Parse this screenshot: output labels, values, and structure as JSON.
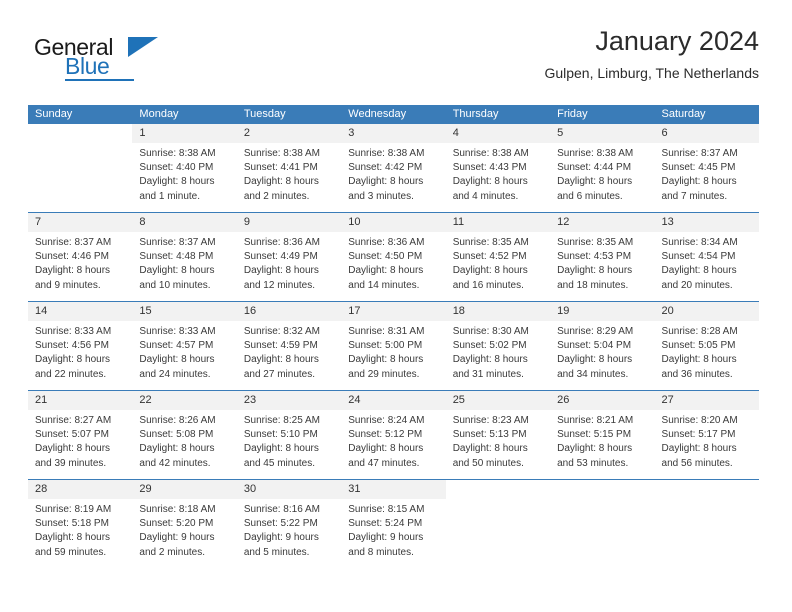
{
  "brand": {
    "name_part1": "General",
    "name_part2": "Blue",
    "logo_icon": "triangle-flag-icon"
  },
  "header": {
    "title": "January 2024",
    "subtitle": "Gulpen, Limburg, The Netherlands"
  },
  "colors": {
    "header_blue": "#3a7cb8",
    "brand_blue": "#1f72b8",
    "day_band_gray": "#f2f2f2",
    "text": "#3a3a3a"
  },
  "weekdays": [
    "Sunday",
    "Monday",
    "Tuesday",
    "Wednesday",
    "Thursday",
    "Friday",
    "Saturday"
  ],
  "weeks": [
    [
      {
        "day": "",
        "lines": [
          "",
          "",
          "",
          ""
        ]
      },
      {
        "day": "1",
        "lines": [
          "Sunrise: 8:38 AM",
          "Sunset: 4:40 PM",
          "Daylight: 8 hours",
          "and 1 minute."
        ]
      },
      {
        "day": "2",
        "lines": [
          "Sunrise: 8:38 AM",
          "Sunset: 4:41 PM",
          "Daylight: 8 hours",
          "and 2 minutes."
        ]
      },
      {
        "day": "3",
        "lines": [
          "Sunrise: 8:38 AM",
          "Sunset: 4:42 PM",
          "Daylight: 8 hours",
          "and 3 minutes."
        ]
      },
      {
        "day": "4",
        "lines": [
          "Sunrise: 8:38 AM",
          "Sunset: 4:43 PM",
          "Daylight: 8 hours",
          "and 4 minutes."
        ]
      },
      {
        "day": "5",
        "lines": [
          "Sunrise: 8:38 AM",
          "Sunset: 4:44 PM",
          "Daylight: 8 hours",
          "and 6 minutes."
        ]
      },
      {
        "day": "6",
        "lines": [
          "Sunrise: 8:37 AM",
          "Sunset: 4:45 PM",
          "Daylight: 8 hours",
          "and 7 minutes."
        ]
      }
    ],
    [
      {
        "day": "7",
        "lines": [
          "Sunrise: 8:37 AM",
          "Sunset: 4:46 PM",
          "Daylight: 8 hours",
          "and 9 minutes."
        ]
      },
      {
        "day": "8",
        "lines": [
          "Sunrise: 8:37 AM",
          "Sunset: 4:48 PM",
          "Daylight: 8 hours",
          "and 10 minutes."
        ]
      },
      {
        "day": "9",
        "lines": [
          "Sunrise: 8:36 AM",
          "Sunset: 4:49 PM",
          "Daylight: 8 hours",
          "and 12 minutes."
        ]
      },
      {
        "day": "10",
        "lines": [
          "Sunrise: 8:36 AM",
          "Sunset: 4:50 PM",
          "Daylight: 8 hours",
          "and 14 minutes."
        ]
      },
      {
        "day": "11",
        "lines": [
          "Sunrise: 8:35 AM",
          "Sunset: 4:52 PM",
          "Daylight: 8 hours",
          "and 16 minutes."
        ]
      },
      {
        "day": "12",
        "lines": [
          "Sunrise: 8:35 AM",
          "Sunset: 4:53 PM",
          "Daylight: 8 hours",
          "and 18 minutes."
        ]
      },
      {
        "day": "13",
        "lines": [
          "Sunrise: 8:34 AM",
          "Sunset: 4:54 PM",
          "Daylight: 8 hours",
          "and 20 minutes."
        ]
      }
    ],
    [
      {
        "day": "14",
        "lines": [
          "Sunrise: 8:33 AM",
          "Sunset: 4:56 PM",
          "Daylight: 8 hours",
          "and 22 minutes."
        ]
      },
      {
        "day": "15",
        "lines": [
          "Sunrise: 8:33 AM",
          "Sunset: 4:57 PM",
          "Daylight: 8 hours",
          "and 24 minutes."
        ]
      },
      {
        "day": "16",
        "lines": [
          "Sunrise: 8:32 AM",
          "Sunset: 4:59 PM",
          "Daylight: 8 hours",
          "and 27 minutes."
        ]
      },
      {
        "day": "17",
        "lines": [
          "Sunrise: 8:31 AM",
          "Sunset: 5:00 PM",
          "Daylight: 8 hours",
          "and 29 minutes."
        ]
      },
      {
        "day": "18",
        "lines": [
          "Sunrise: 8:30 AM",
          "Sunset: 5:02 PM",
          "Daylight: 8 hours",
          "and 31 minutes."
        ]
      },
      {
        "day": "19",
        "lines": [
          "Sunrise: 8:29 AM",
          "Sunset: 5:04 PM",
          "Daylight: 8 hours",
          "and 34 minutes."
        ]
      },
      {
        "day": "20",
        "lines": [
          "Sunrise: 8:28 AM",
          "Sunset: 5:05 PM",
          "Daylight: 8 hours",
          "and 36 minutes."
        ]
      }
    ],
    [
      {
        "day": "21",
        "lines": [
          "Sunrise: 8:27 AM",
          "Sunset: 5:07 PM",
          "Daylight: 8 hours",
          "and 39 minutes."
        ]
      },
      {
        "day": "22",
        "lines": [
          "Sunrise: 8:26 AM",
          "Sunset: 5:08 PM",
          "Daylight: 8 hours",
          "and 42 minutes."
        ]
      },
      {
        "day": "23",
        "lines": [
          "Sunrise: 8:25 AM",
          "Sunset: 5:10 PM",
          "Daylight: 8 hours",
          "and 45 minutes."
        ]
      },
      {
        "day": "24",
        "lines": [
          "Sunrise: 8:24 AM",
          "Sunset: 5:12 PM",
          "Daylight: 8 hours",
          "and 47 minutes."
        ]
      },
      {
        "day": "25",
        "lines": [
          "Sunrise: 8:23 AM",
          "Sunset: 5:13 PM",
          "Daylight: 8 hours",
          "and 50 minutes."
        ]
      },
      {
        "day": "26",
        "lines": [
          "Sunrise: 8:21 AM",
          "Sunset: 5:15 PM",
          "Daylight: 8 hours",
          "and 53 minutes."
        ]
      },
      {
        "day": "27",
        "lines": [
          "Sunrise: 8:20 AM",
          "Sunset: 5:17 PM",
          "Daylight: 8 hours",
          "and 56 minutes."
        ]
      }
    ],
    [
      {
        "day": "28",
        "lines": [
          "Sunrise: 8:19 AM",
          "Sunset: 5:18 PM",
          "Daylight: 8 hours",
          "and 59 minutes."
        ]
      },
      {
        "day": "29",
        "lines": [
          "Sunrise: 8:18 AM",
          "Sunset: 5:20 PM",
          "Daylight: 9 hours",
          "and 2 minutes."
        ]
      },
      {
        "day": "30",
        "lines": [
          "Sunrise: 8:16 AM",
          "Sunset: 5:22 PM",
          "Daylight: 9 hours",
          "and 5 minutes."
        ]
      },
      {
        "day": "31",
        "lines": [
          "Sunrise: 8:15 AM",
          "Sunset: 5:24 PM",
          "Daylight: 9 hours",
          "and 8 minutes."
        ]
      },
      {
        "day": "",
        "lines": [
          "",
          "",
          "",
          ""
        ]
      },
      {
        "day": "",
        "lines": [
          "",
          "",
          "",
          ""
        ]
      },
      {
        "day": "",
        "lines": [
          "",
          "",
          "",
          ""
        ]
      }
    ]
  ]
}
